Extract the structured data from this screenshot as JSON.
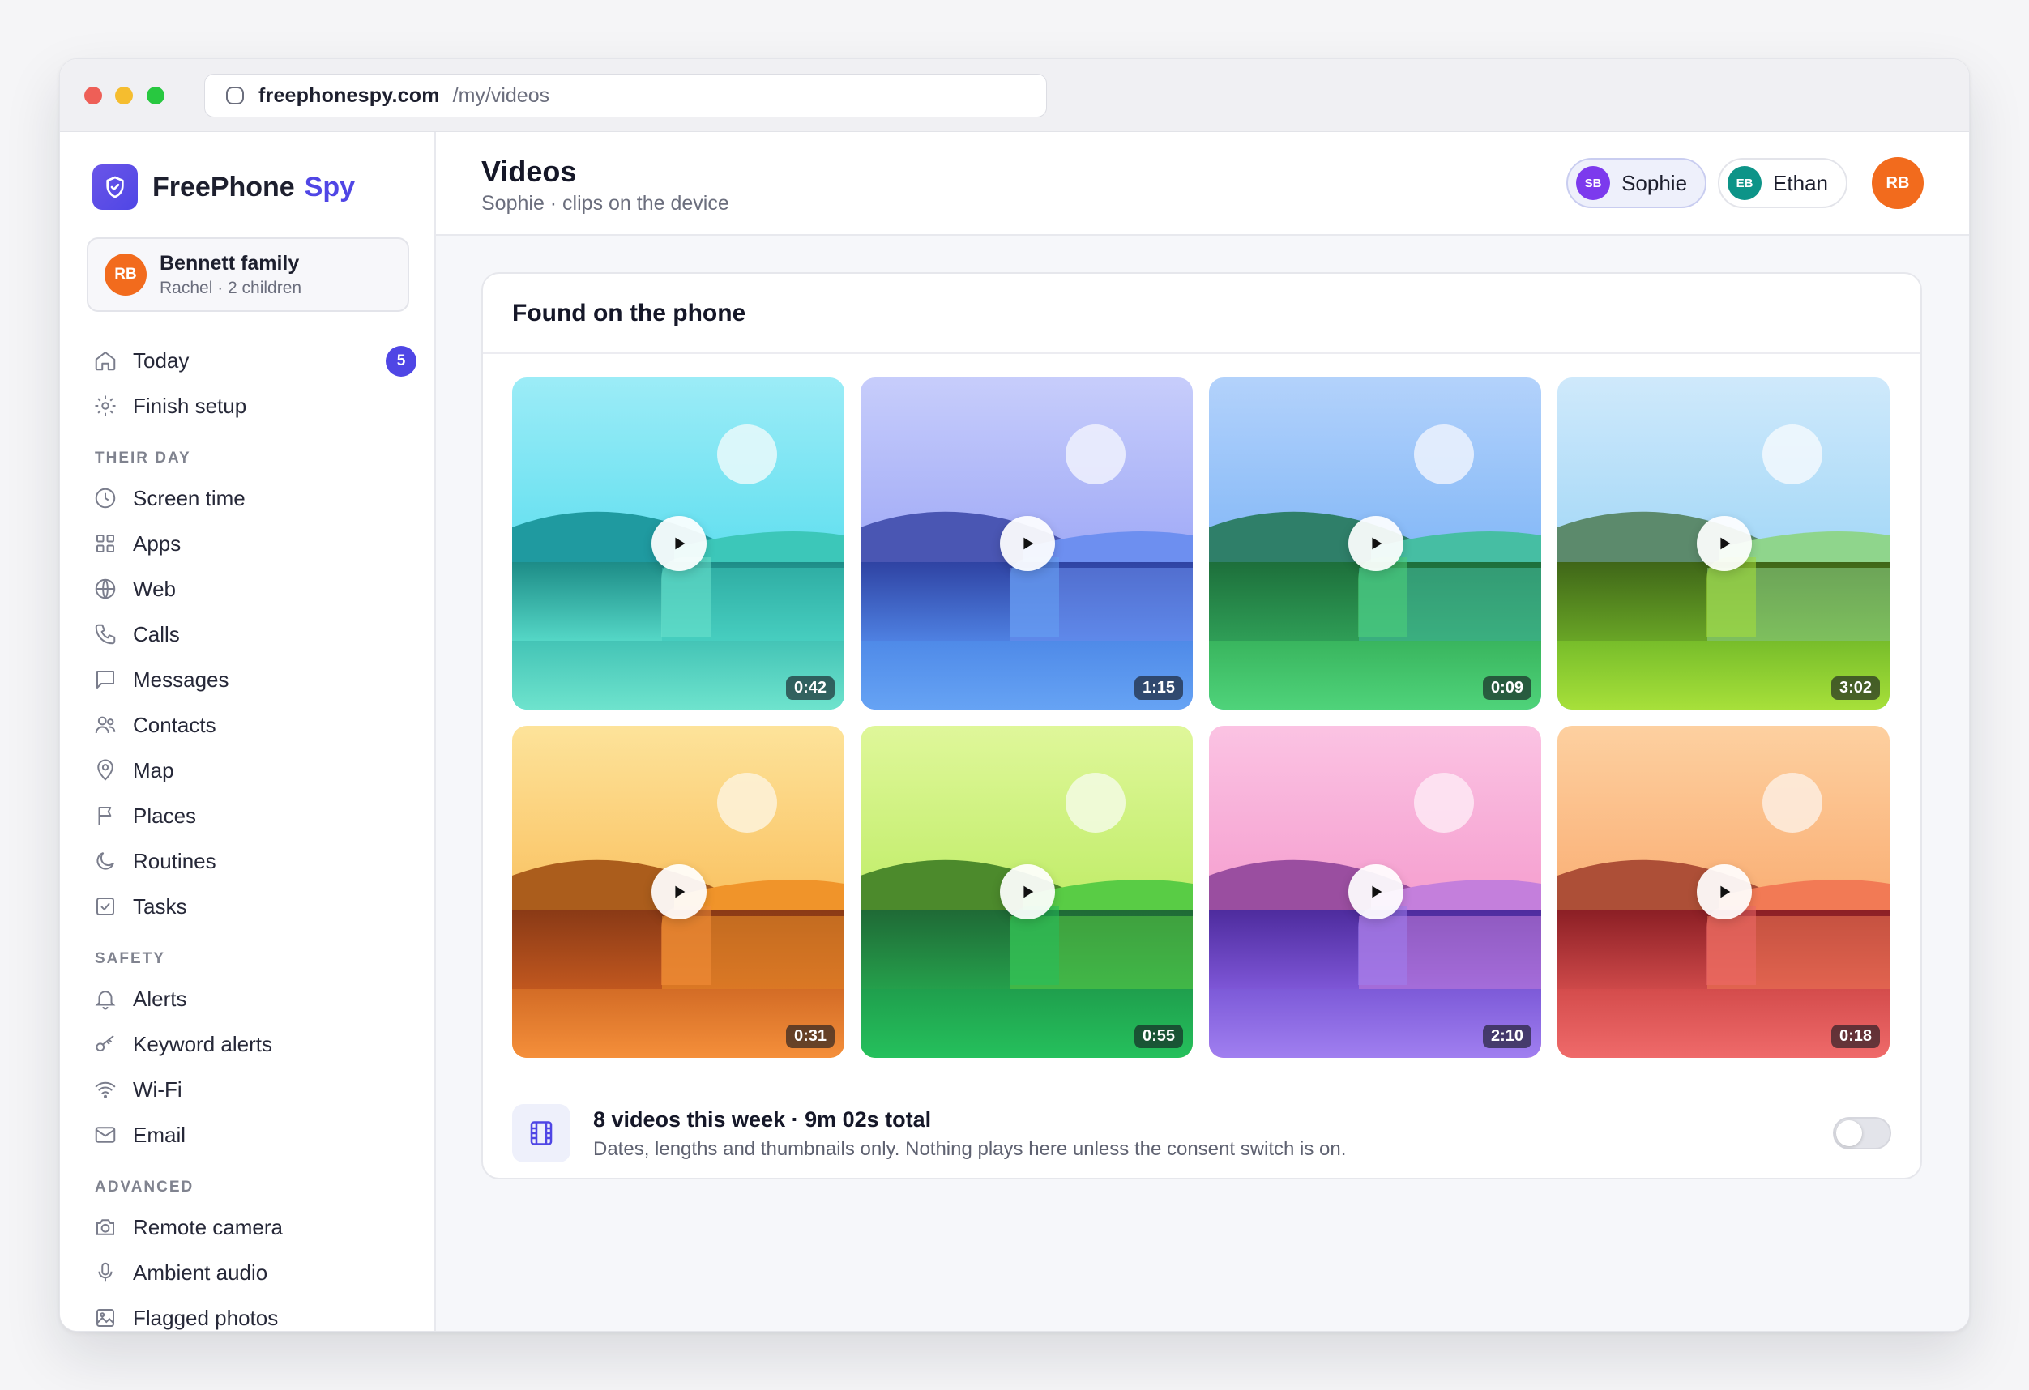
{
  "browser": {
    "domain": "freephonespy.com",
    "path": "/my/videos"
  },
  "brand": {
    "name": "FreePhone",
    "accent": "Spy"
  },
  "family": {
    "initials": "RB",
    "name": "Bennett family",
    "sub": "Rachel · 2 children"
  },
  "nav": {
    "today": {
      "label": "Today",
      "badge": "5",
      "icon": "home-icon"
    },
    "finish_setup": {
      "label": "Finish setup",
      "icon": "gear-icon"
    },
    "section_their_day": "THEIR DAY",
    "their_day": [
      {
        "label": "Screen time",
        "icon": "clock-icon"
      },
      {
        "label": "Apps",
        "icon": "grid-icon"
      },
      {
        "label": "Web",
        "icon": "globe-icon"
      },
      {
        "label": "Calls",
        "icon": "phone-icon"
      },
      {
        "label": "Messages",
        "icon": "message-icon"
      },
      {
        "label": "Contacts",
        "icon": "users-icon"
      },
      {
        "label": "Map",
        "icon": "pin-icon"
      },
      {
        "label": "Places",
        "icon": "flag-icon"
      },
      {
        "label": "Routines",
        "icon": "moon-icon"
      },
      {
        "label": "Tasks",
        "icon": "checkbox-icon"
      }
    ],
    "section_safety": "SAFETY",
    "safety": [
      {
        "label": "Alerts",
        "icon": "bell-icon"
      },
      {
        "label": "Keyword alerts",
        "icon": "key-icon"
      },
      {
        "label": "Wi-Fi",
        "icon": "wifi-icon"
      },
      {
        "label": "Email",
        "icon": "mail-icon"
      }
    ],
    "section_advanced": "ADVANCED",
    "advanced": [
      {
        "label": "Remote camera",
        "icon": "camera-icon"
      },
      {
        "label": "Ambient audio",
        "icon": "mic-icon"
      },
      {
        "label": "Flagged photos",
        "icon": "image-icon"
      }
    ]
  },
  "header": {
    "title": "Videos",
    "subtitle": "Sophie · clips on the device",
    "children": [
      {
        "initials": "SB",
        "name": "Sophie",
        "color": "#7c3aed",
        "active": true
      },
      {
        "initials": "EB",
        "name": "Ethan",
        "color": "#0d9488",
        "active": false
      }
    ],
    "user_initials": "RB"
  },
  "panel": {
    "title": "Found on the phone",
    "videos": [
      {
        "duration": "0:42",
        "palette": "teal"
      },
      {
        "duration": "1:15",
        "palette": "indigo"
      },
      {
        "duration": "0:09",
        "palette": "sky-green"
      },
      {
        "duration": "3:02",
        "palette": "lime"
      },
      {
        "duration": "0:31",
        "palette": "amber"
      },
      {
        "duration": "0:55",
        "palette": "green"
      },
      {
        "duration": "2:10",
        "palette": "pink-violet"
      },
      {
        "duration": "0:18",
        "palette": "peach-red"
      }
    ],
    "summary_title": "8 videos this week · 9m 02s total",
    "summary_note": "Dates, lengths and thumbnails only. Nothing plays here unless the consent switch is on.",
    "consent_switch_on": false
  },
  "colors": {
    "accent": "#4f46e5",
    "avatar_orange": "#f26b1d"
  }
}
